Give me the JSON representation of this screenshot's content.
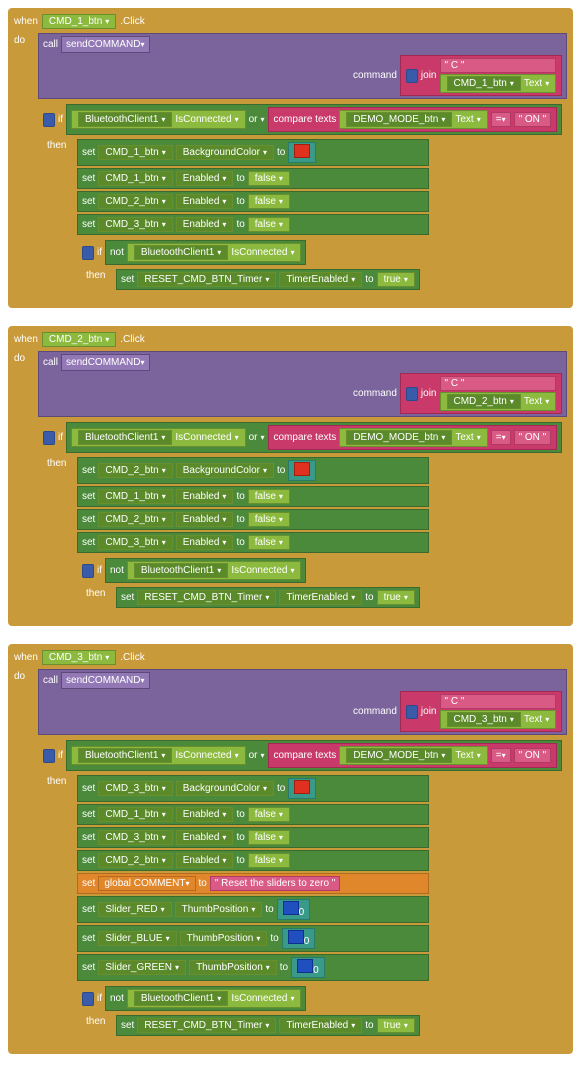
{
  "words": {
    "when": "when",
    "do": "do",
    "call": "call",
    "command": "command",
    "if": "if",
    "then": "then",
    "set": "set",
    "to": "to",
    "or": "or",
    "not": "not",
    "join": "join"
  },
  "event": {
    "click": ".Click"
  },
  "components": {
    "cmd1": "CMD_1_btn",
    "cmd2": "CMD_2_btn",
    "cmd3": "CMD_3_btn",
    "bt1": "BluetoothClient1",
    "demoMode": "DEMO_MODE_btn",
    "resetTimer": "RESET_CMD_BTN_Timer",
    "sliderRed": "Slider_RED",
    "sliderBlue": "Slider_BLUE",
    "sliderGreen": "Slider_GREEN"
  },
  "props": {
    "text": "Text",
    "isConnected": "IsConnected",
    "bgColor": "BackgroundColor",
    "enabled": "Enabled",
    "timerEnabled": "TimerEnabled",
    "thumbPos": "ThumbPosition"
  },
  "procs": {
    "sendCommand": "sendCOMMAND"
  },
  "globals": {
    "comment": "global COMMENT"
  },
  "strings": {
    "C": "\" C \"",
    "ON": "\" ON \"",
    "eq": "=",
    "resetSliders": "\" Reset the sliders to zero \""
  },
  "ops": {
    "compareTexts": "compare texts"
  },
  "vals": {
    "false": "false",
    "true": "true",
    "zero": "0"
  }
}
